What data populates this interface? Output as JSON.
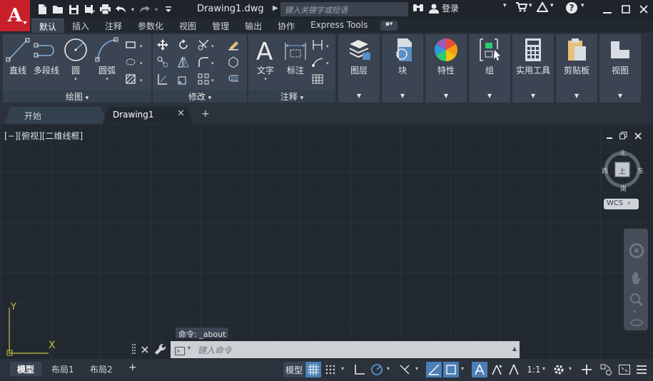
{
  "app": {
    "logo_letter": "A",
    "document_title": "Drawing1.dwg",
    "search_placeholder": "键入关键字或短语",
    "login_label": "登录",
    "help_label": "?"
  },
  "ribbon_tabs": [
    "默认",
    "插入",
    "注释",
    "参数化",
    "视图",
    "管理",
    "输出",
    "协作",
    "Express Tools"
  ],
  "ribbon_tab_extra": "▪▾",
  "panels": {
    "draw": {
      "title": "绘图",
      "tools": [
        "直线",
        "多段线",
        "圆",
        "圆弧"
      ]
    },
    "modify": {
      "title": "修改"
    },
    "annotation": {
      "title": "注释",
      "tools": [
        "文字",
        "标注"
      ]
    },
    "layers": {
      "label": "图层"
    },
    "block": {
      "label": "块"
    },
    "properties": {
      "label": "特性"
    },
    "groups": {
      "label": "组"
    },
    "utilities": {
      "label": "实用工具"
    },
    "clipboard": {
      "label": "剪贴板"
    },
    "view": {
      "label": "视图"
    }
  },
  "doc_tabs": {
    "home": "开始",
    "active": "Drawing1",
    "close": "✕",
    "add": "+"
  },
  "viewport": {
    "label": "[−][俯视][二维线框]",
    "compass": {
      "north": "北",
      "south": "南",
      "east": "东",
      "west": "西",
      "top": "上"
    },
    "wcs": "WCS",
    "ucs_x": "X",
    "ucs_y": "Y"
  },
  "command": {
    "history": "命令: _about",
    "placeholder": "键入命令"
  },
  "layout_tabs": [
    "模型",
    "布局1",
    "布局2"
  ],
  "status": {
    "model": "模型",
    "scale": "1:1"
  },
  "colors": {
    "logo_red": "#c8202a",
    "accent_blue": "#4b7fb6",
    "canvas": "#212830",
    "ribbon_panel": "#3b4452"
  }
}
